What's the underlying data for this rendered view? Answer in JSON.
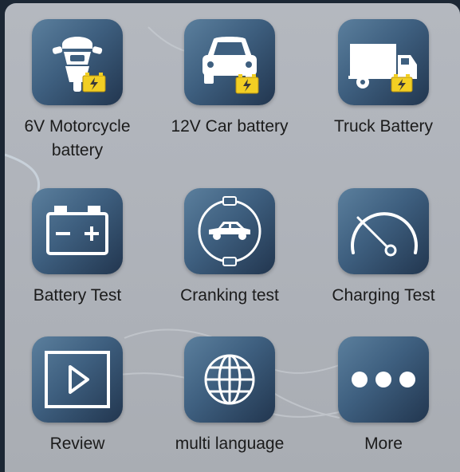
{
  "menu": {
    "items": [
      {
        "label": "6V Motorcycle battery",
        "icon": "motorcycle-battery-icon"
      },
      {
        "label": "12V Car battery",
        "icon": "car-battery-icon"
      },
      {
        "label": "Truck Battery",
        "icon": "truck-battery-icon"
      },
      {
        "label": "Battery Test",
        "icon": "battery-test-icon"
      },
      {
        "label": "Cranking test",
        "icon": "cranking-test-icon"
      },
      {
        "label": "Charging Test",
        "icon": "charging-gauge-icon"
      },
      {
        "label": "Review",
        "icon": "play-review-icon"
      },
      {
        "label": "multi language",
        "icon": "globe-icon"
      },
      {
        "label": "More",
        "icon": "more-dots-icon"
      }
    ]
  },
  "colors": {
    "tile_gradient_start": "#5b7f9d",
    "tile_gradient_end": "#22364f",
    "battery_badge": "#f2cf23",
    "panel_background": "#b1b5bc"
  }
}
